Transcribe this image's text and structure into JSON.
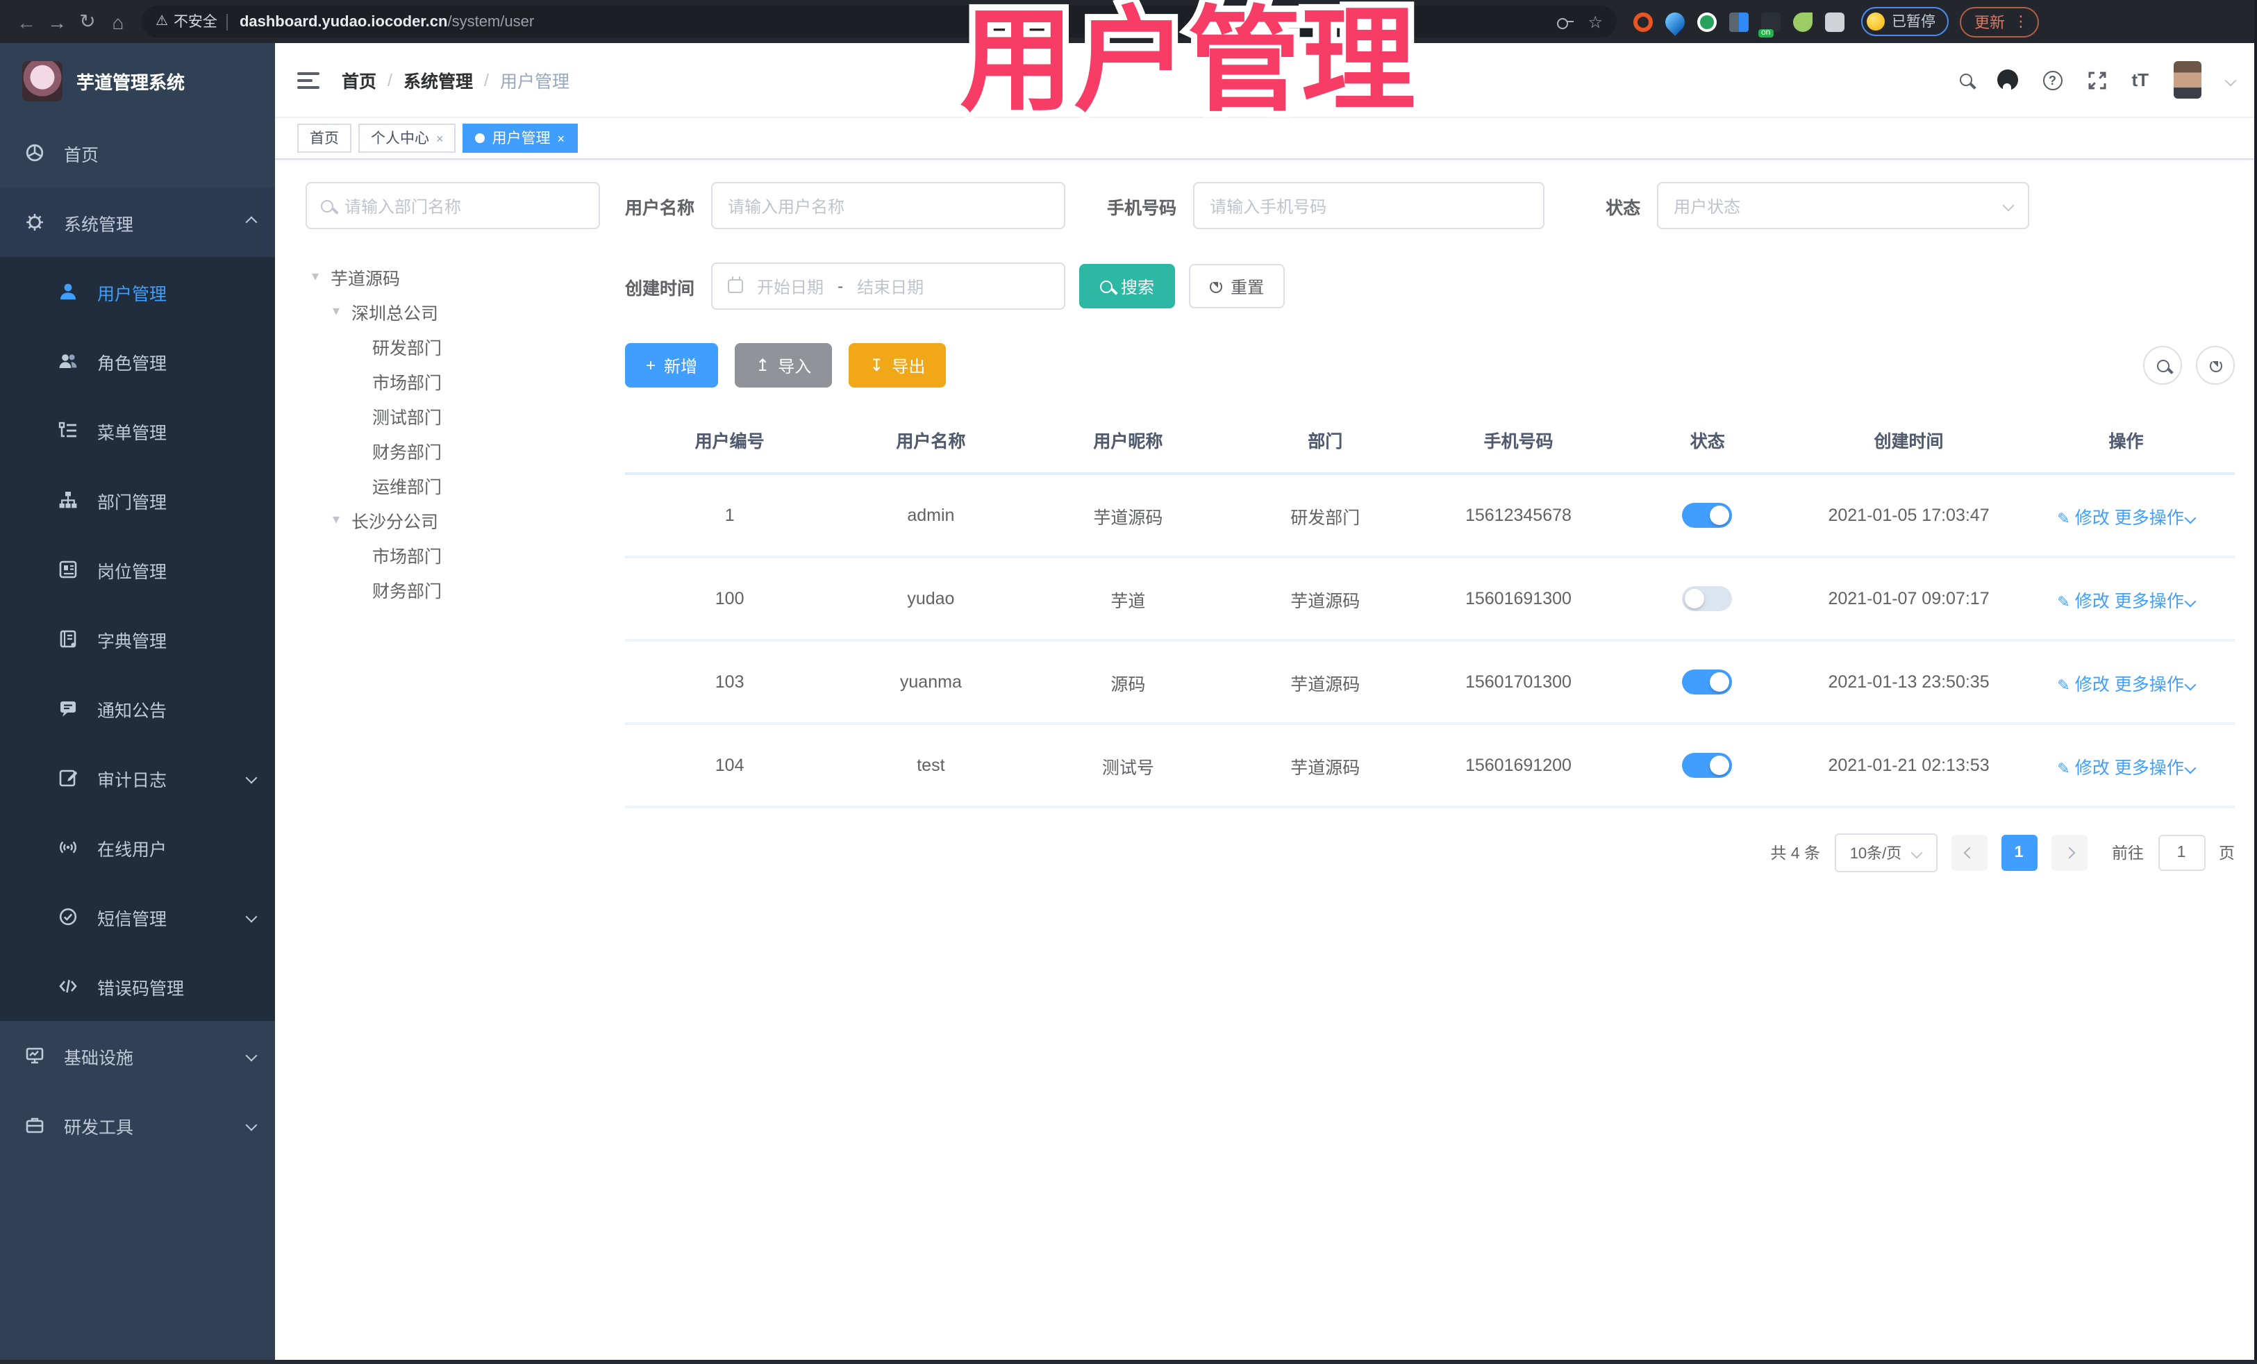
{
  "browser": {
    "security_label": "不安全",
    "url_host": "dashboard.yudao.iocoder.cn",
    "url_path": "/system/user",
    "paused_badge": "已暂停",
    "update_button": "更新"
  },
  "overlay": {
    "title": "用户管理",
    "color": "#f73d66"
  },
  "icons": {
    "back": "←",
    "forward": "→",
    "reload": "↻",
    "home": "⌂",
    "warning": "⚠",
    "star": "☆",
    "help": "?",
    "caret_small": "▾",
    "add": "+",
    "import": "↥",
    "export": "↧",
    "edit": "✎",
    "tab_dot": "●",
    "close": "×",
    "font_size": "tT",
    "kebab": "⋮"
  },
  "header": {
    "breadcrumb": [
      "首页",
      "系统管理",
      "用户管理"
    ],
    "separator": "/"
  },
  "tabs": [
    {
      "label": "首页"
    },
    {
      "label": "个人中心"
    },
    {
      "label": "用户管理"
    }
  ],
  "sidebar": {
    "app_title": "芋道管理系统",
    "home": "首页",
    "system": "系统管理",
    "system_children": [
      "用户管理",
      "角色管理",
      "菜单管理",
      "部门管理",
      "岗位管理",
      "字典管理",
      "通知公告",
      "审计日志",
      "在线用户",
      "短信管理",
      "错误码管理"
    ],
    "infra": "基础设施",
    "dev": "研发工具"
  },
  "dept": {
    "search_placeholder": "请输入部门名称",
    "tree": [
      "芋道源码",
      "深圳总公司",
      "研发部门",
      "市场部门",
      "测试部门",
      "财务部门",
      "运维部门",
      "长沙分公司",
      "市场部门",
      "财务部门"
    ]
  },
  "filters": {
    "username_label": "用户名称",
    "username_placeholder": "请输入用户名称",
    "mobile_label": "手机号码",
    "mobile_placeholder": "请输入手机号码",
    "status_label": "状态",
    "status_placeholder": "用户状态",
    "create_time_label": "创建时间",
    "date_start_placeholder": "开始日期",
    "date_separator": "-",
    "date_end_placeholder": "结束日期",
    "search_button": "搜索",
    "reset_button": "重置"
  },
  "toolbar": {
    "add": "新增",
    "import": "导入",
    "export": "导出"
  },
  "table": {
    "columns": [
      "用户编号",
      "用户名称",
      "用户昵称",
      "部门",
      "手机号码",
      "状态",
      "创建时间",
      "操作"
    ],
    "rows": [
      {
        "id": "1",
        "username": "admin",
        "nickname": "芋道源码",
        "dept": "研发部门",
        "mobile": "15612345678",
        "status": true,
        "created": "2021-01-05 17:03:47"
      },
      {
        "id": "100",
        "username": "yudao",
        "nickname": "芋道",
        "dept": "芋道源码",
        "mobile": "15601691300",
        "status": false,
        "created": "2021-01-07 09:07:17"
      },
      {
        "id": "103",
        "username": "yuanma",
        "nickname": "源码",
        "dept": "芋道源码",
        "mobile": "15601701300",
        "status": true,
        "created": "2021-01-13 23:50:35"
      },
      {
        "id": "104",
        "username": "test",
        "nickname": "测试号",
        "dept": "芋道源码",
        "mobile": "15601691200",
        "status": true,
        "created": "2021-01-21 02:13:53"
      }
    ],
    "actions": {
      "edit": "修改",
      "more": "更多操作"
    }
  },
  "pagination": {
    "total": "共 4 条",
    "page_size": "10条/页",
    "current": "1",
    "goto_label": "前往",
    "goto_value": "1",
    "page_label": "页"
  }
}
